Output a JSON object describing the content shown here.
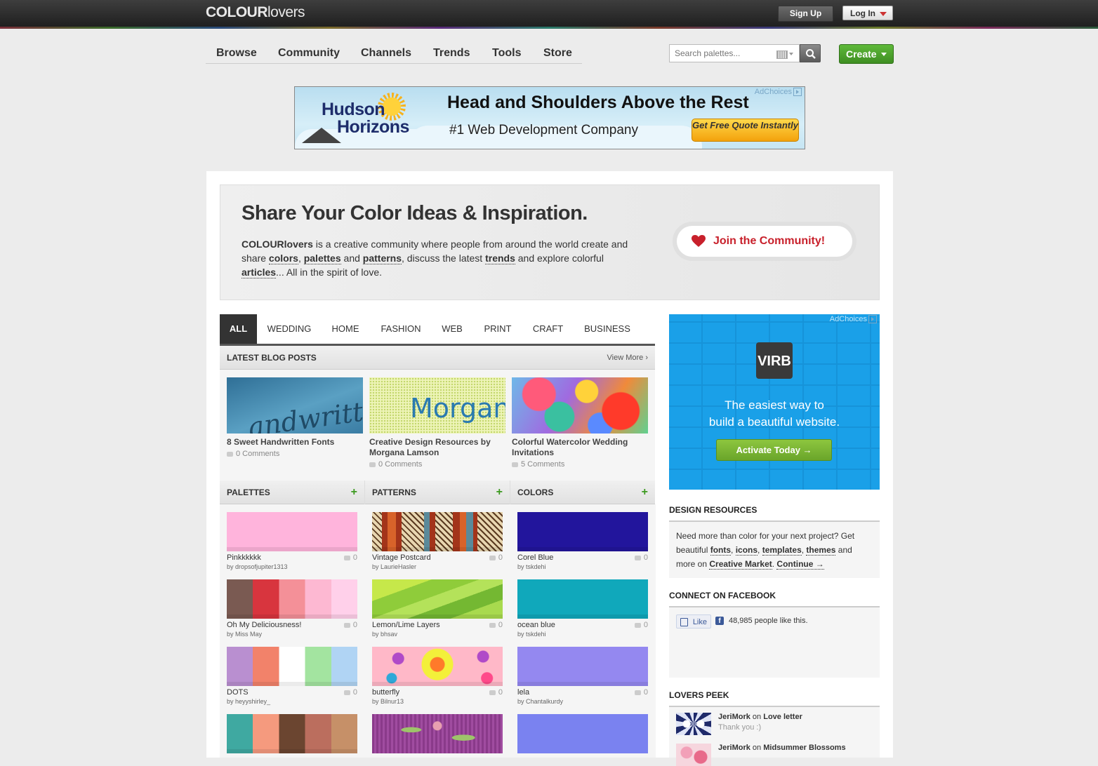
{
  "topbar": {
    "logo_bold": "COLOUR",
    "logo_light": "lovers",
    "signup": "Sign Up",
    "login": "Log In"
  },
  "nav": {
    "items": [
      "Browse",
      "Community",
      "Channels",
      "Trends",
      "Tools",
      "Store"
    ],
    "search_placeholder": "Search palettes...",
    "create": "Create"
  },
  "ad_top": {
    "adchoices": "AdChoices",
    "brand_line1": "Hudson",
    "brand_line2": "Horizons",
    "headline": "Head and Shoulders Above the Rest",
    "sub": "#1 Web Development Company",
    "button": "Get Free Quote Instantly"
  },
  "hero": {
    "title": "Share Your Color Ideas & Inspiration.",
    "p1": "COLOURlovers",
    "p2": " is a creative community where people from around the world create and share ",
    "w_colors": "colors",
    "s1": ", ",
    "w_palettes": "palettes",
    "s2": " and ",
    "w_patterns": "patterns",
    "s3": ", discuss the latest ",
    "w_trends": "trends",
    "s4": " and explore colorful ",
    "w_articles": "articles",
    "s5": "... All in the spirit of love.",
    "join": "Join the Community!"
  },
  "tabs": [
    "ALL",
    "WEDDING",
    "HOME",
    "FASHION",
    "WEB",
    "PRINT",
    "CRAFT",
    "BUSINESS"
  ],
  "blog": {
    "header": "LATEST BLOG POSTS",
    "view_more": "View More ›",
    "posts": [
      {
        "title": "8 Sweet Handwritten Fonts",
        "comments": "0 Comments",
        "thumb_text": "andwritt"
      },
      {
        "title": "Creative Design Resources by Morgana Lamson",
        "comments": "0 Comments",
        "thumb_text": "Morgana"
      },
      {
        "title": "Colorful Watercolor Wedding Invitations",
        "comments": "5 Comments"
      }
    ]
  },
  "palettes": {
    "header": "PALETTES",
    "plus": "+",
    "items": [
      {
        "name": "Pinkkkkkk",
        "by": "by dropsofjupiter1313",
        "count": "0",
        "colors": [
          "#ffb4dc"
        ]
      },
      {
        "name": "Oh My Deliciousness!",
        "by": "by Miss May",
        "count": "0",
        "colors": [
          "#7a5a52",
          "#d8353e",
          "#f49098",
          "#fdb8d2",
          "#ffd0ea"
        ]
      },
      {
        "name": "DOTS",
        "by": "by heyyshirley_",
        "count": "0",
        "colors": [
          "#b98fd0",
          "#f2826a",
          "#ffffff",
          "#a3e4a0",
          "#b0d4f4"
        ]
      },
      {
        "name": "",
        "by": "",
        "count": "",
        "colors": [
          "#3fa9a1",
          "#f59a7e",
          "#6b4530",
          "#bb6e5e",
          "#c69068"
        ]
      }
    ]
  },
  "patterns": {
    "header": "PATTERNS",
    "plus": "+",
    "items": [
      {
        "name": "Vintage Postcard",
        "by": "by LaurieHasler",
        "count": "0"
      },
      {
        "name": "Lemon/Lime Layers",
        "by": "by bhsav",
        "count": "0"
      },
      {
        "name": "butterfly",
        "by": "by Bilnur13",
        "count": "0"
      },
      {
        "name": "",
        "by": "",
        "count": ""
      }
    ]
  },
  "colors": {
    "header": "COLORS",
    "plus": "+",
    "items": [
      {
        "name": "Corel Blue",
        "by": "by tskdehi",
        "count": "0",
        "color": "#22159c"
      },
      {
        "name": "ocean blue",
        "by": "by tskdehi",
        "count": "0",
        "color": "#10a8bb"
      },
      {
        "name": "lela",
        "by": "by Chantalkurdy",
        "count": "0",
        "color": "#9488f0"
      },
      {
        "name": "",
        "by": "",
        "count": "",
        "color": "#7a82f0"
      }
    ]
  },
  "ad_side": {
    "adchoices": "AdChoices",
    "logo": "VIRB",
    "line1": "The easiest way to",
    "line2": "build a beautiful website.",
    "button": "Activate Today →"
  },
  "design_resources": {
    "header": "DESIGN RESOURCES",
    "t1": "Need more than color for your next project? Get beautiful ",
    "fonts": "fonts",
    "c1": ", ",
    "icons": "icons",
    "c2": ", ",
    "templates": "templates",
    "c3": ", ",
    "themes": "themes",
    "t2": " and more on ",
    "market": "Creative Market",
    "t3": ". ",
    "cont": "Continue →"
  },
  "facebook": {
    "header": "CONNECT ON FACEBOOK",
    "like": "Like",
    "count_text": "48,985 people like this."
  },
  "lovers_peek": {
    "header": "LOVERS PEEK",
    "items": [
      {
        "user": "JeriMork",
        "on": " on ",
        "target": "Love letter",
        "msg": "Thank you :)"
      },
      {
        "user": "JeriMork",
        "on": " on ",
        "target": "Midsummer Blossoms",
        "msg": ""
      }
    ]
  },
  "colors_accent": {
    "green": "#3e8e22",
    "red": "#c8202b",
    "virb_blue": "#1aa0e8"
  }
}
